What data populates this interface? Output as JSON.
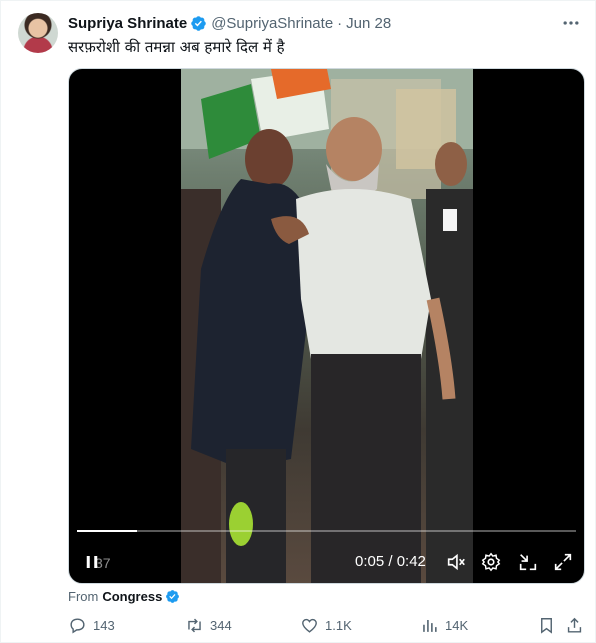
{
  "tweet": {
    "author_name": "Supriya Shrinate",
    "handle": "@SupriyaShrinate",
    "separator": "·",
    "date": "Jun 28",
    "text": "सरफ़रोशी की तमन्ना अब हमारे दिल में है"
  },
  "video": {
    "progress_fraction": 0.12,
    "views": "37",
    "time_display": "0:05 / 0:42"
  },
  "source": {
    "prefix": "From",
    "name": "Congress"
  },
  "metrics": {
    "replies": "143",
    "retweets": "344",
    "likes": "1.1K",
    "views": "14K"
  },
  "colors": {
    "verified_blue": "#1d9bf0",
    "muted_text": "#536471"
  },
  "icons": [
    "more-icon",
    "verified-icon",
    "pause-icon",
    "mute-icon",
    "settings-icon",
    "minimize-icon",
    "fullscreen-icon",
    "reply-icon",
    "retweet-icon",
    "like-icon",
    "views-icon",
    "bookmark-icon",
    "share-icon"
  ]
}
